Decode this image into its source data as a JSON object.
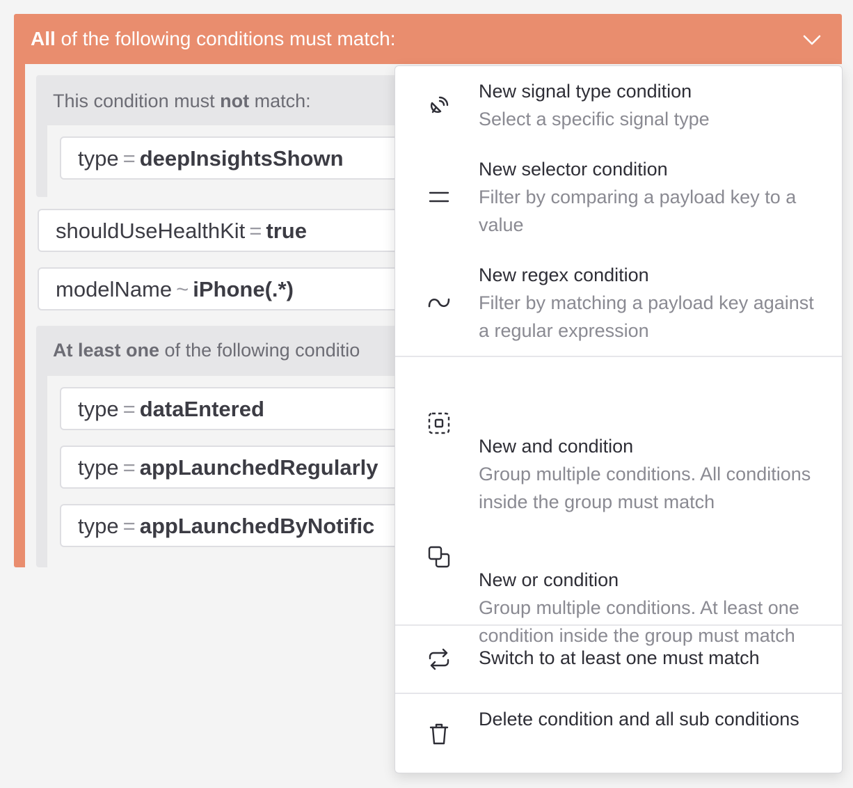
{
  "outer": {
    "title_bold": "All",
    "title_rest": " of the following conditions must match:"
  },
  "not_group": {
    "title_pre": "This condition must ",
    "title_bold": "not",
    "title_post": " match:",
    "condition": {
      "key": "type",
      "op": "=",
      "value": "deepInsightsShown"
    }
  },
  "conditions": [
    {
      "key": "shouldUseHealthKit",
      "op": "=",
      "value": "true"
    },
    {
      "key": "modelName",
      "op": "~",
      "value": "iPhone(.*)"
    }
  ],
  "or_group": {
    "title_bold": "At least one",
    "title_rest": " of the following conditio",
    "conditions": [
      {
        "key": "type",
        "op": "=",
        "value": "dataEntered"
      },
      {
        "key": "type",
        "op": "=",
        "value": "appLaunchedRegularly"
      },
      {
        "key": "type",
        "op": "=",
        "value": "appLaunchedByNotific"
      }
    ]
  },
  "menu": {
    "items": [
      {
        "icon": "satellite-dish-icon",
        "title": "New signal type condition",
        "desc": "Select a specific signal type"
      },
      {
        "icon": "equals-icon",
        "title": "New selector condition",
        "desc": "Filter by comparing a payload key to a value"
      },
      {
        "icon": "tilde-icon",
        "title": "New regex condition",
        "desc": "Filter by matching a payload key against a regular expression"
      },
      {
        "icon": "dashed-group-icon",
        "title": "New and condition",
        "desc": "Group multiple conditions. All conditions inside the group must match"
      },
      {
        "icon": "overlapping-squares-icon",
        "title": "New or condition",
        "desc": "Group multiple conditions. At least one condition inside the group must match"
      },
      {
        "icon": "switch-arrows-icon",
        "title": "Switch to at least one must match",
        "desc": ""
      },
      {
        "icon": "trash-icon",
        "title": "Delete condition and all sub conditions",
        "desc": ""
      }
    ]
  },
  "colors": {
    "accent": "#e98d6e",
    "background": "#f4f4f4",
    "group": "#e6e6e8"
  }
}
